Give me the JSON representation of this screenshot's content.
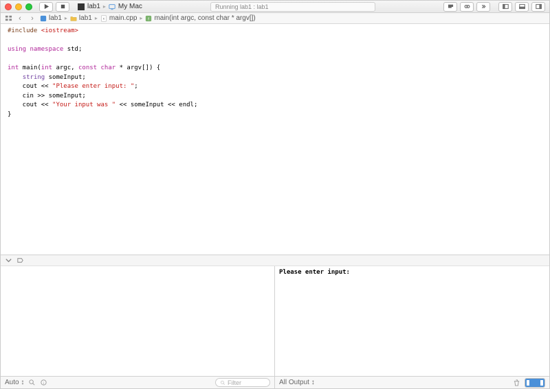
{
  "titlebar": {
    "run_tooltip": "Run",
    "stop_tooltip": "Stop",
    "scheme_target": "lab1",
    "scheme_device": "My Mac",
    "activity": "Running lab1 : lab1"
  },
  "jumpbar": {
    "project": "lab1",
    "folder": "lab1",
    "file": "main.cpp",
    "symbol": "main(int argc, const char * argv[])"
  },
  "code": {
    "l1_pp": "#include",
    "l1_inc": " <iostream>",
    "l2_kw1": "using",
    "l2_kw2": " namespace",
    "l2_rest": " std;",
    "l3_kw1": "int",
    "l3_mid": " main(",
    "l3_kw2": "int",
    "l3_mid2": " argc, ",
    "l3_kw3": "const",
    "l3_kw4": " char",
    "l3_end": " * argv[]) {",
    "l4_pre": "    ",
    "l4_ty": "string",
    "l4_end": " someInput;",
    "l5_pre": "    cout << ",
    "l5_str": "\"Please enter input: \"",
    "l5_end": ";",
    "l6": "    cin >> someInput;",
    "l7_pre": "    cout << ",
    "l7_str": "\"Your input was \"",
    "l7_end": " << someInput << endl;",
    "l8": "}"
  },
  "console": {
    "output": "Please enter input: "
  },
  "debug_bottom": {
    "auto_label": "Auto",
    "filter_placeholder": "Filter",
    "all_output_label": "All Output"
  }
}
